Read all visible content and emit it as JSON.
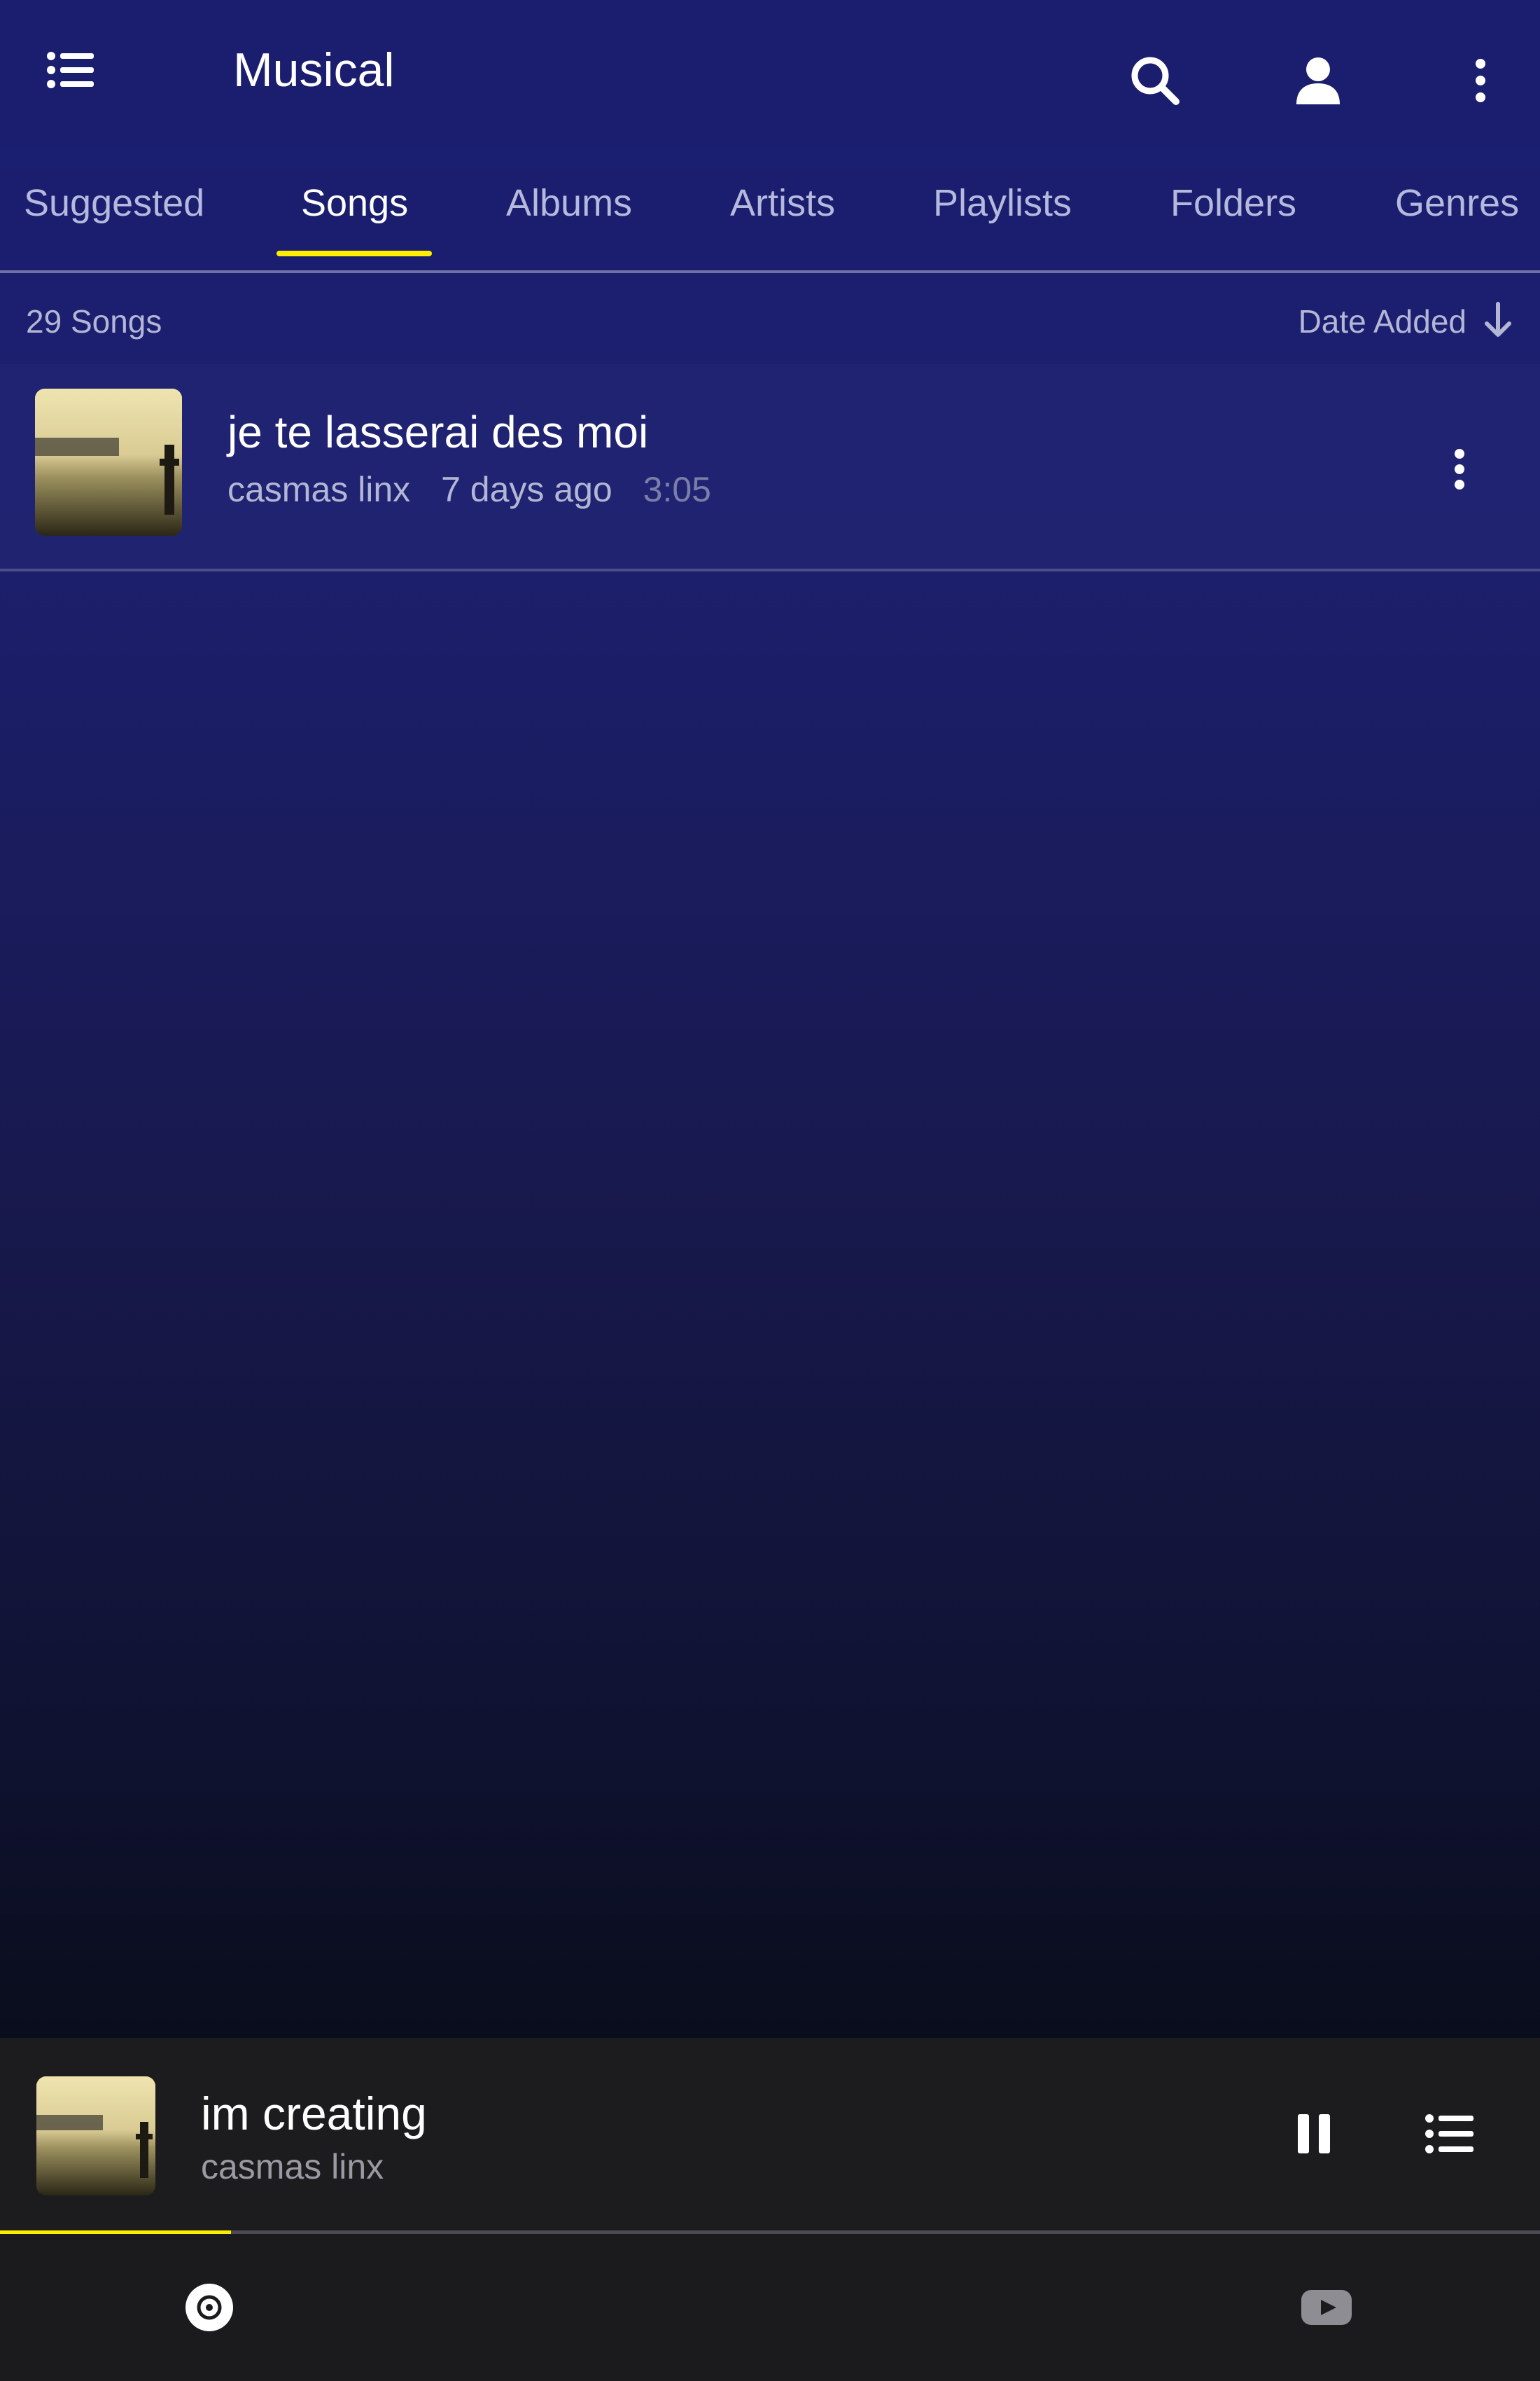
{
  "app": {
    "title": "Musical"
  },
  "icons": {
    "menu": "menu-list-icon",
    "search": "search-icon",
    "account": "account-icon",
    "more": "more-vert-icon",
    "sort": "arrow-down-icon",
    "pause": "pause-icon",
    "queue": "queue-list-icon",
    "library": "disc-icon",
    "youtube": "youtube-icon"
  },
  "tabs": [
    {
      "label": "Suggested",
      "active": false
    },
    {
      "label": "Songs",
      "active": true
    },
    {
      "label": "Albums",
      "active": false
    },
    {
      "label": "Artists",
      "active": false
    },
    {
      "label": "Playlists",
      "active": false
    },
    {
      "label": "Folders",
      "active": false
    },
    {
      "label": "Genres",
      "active": false
    }
  ],
  "list": {
    "count_label": "29 Songs",
    "sort_label": "Date Added",
    "songs": [
      {
        "title": "je te lasserai des moi",
        "artist": "casmas linx",
        "added": "7 days ago",
        "duration": "3:05"
      }
    ]
  },
  "now_playing": {
    "title": "im creating",
    "artist": "casmas linx",
    "progress": 0.15
  },
  "colors": {
    "accent": "#ffee00",
    "background": "#1b1e6e",
    "player_bg": "#1c1c1f"
  }
}
